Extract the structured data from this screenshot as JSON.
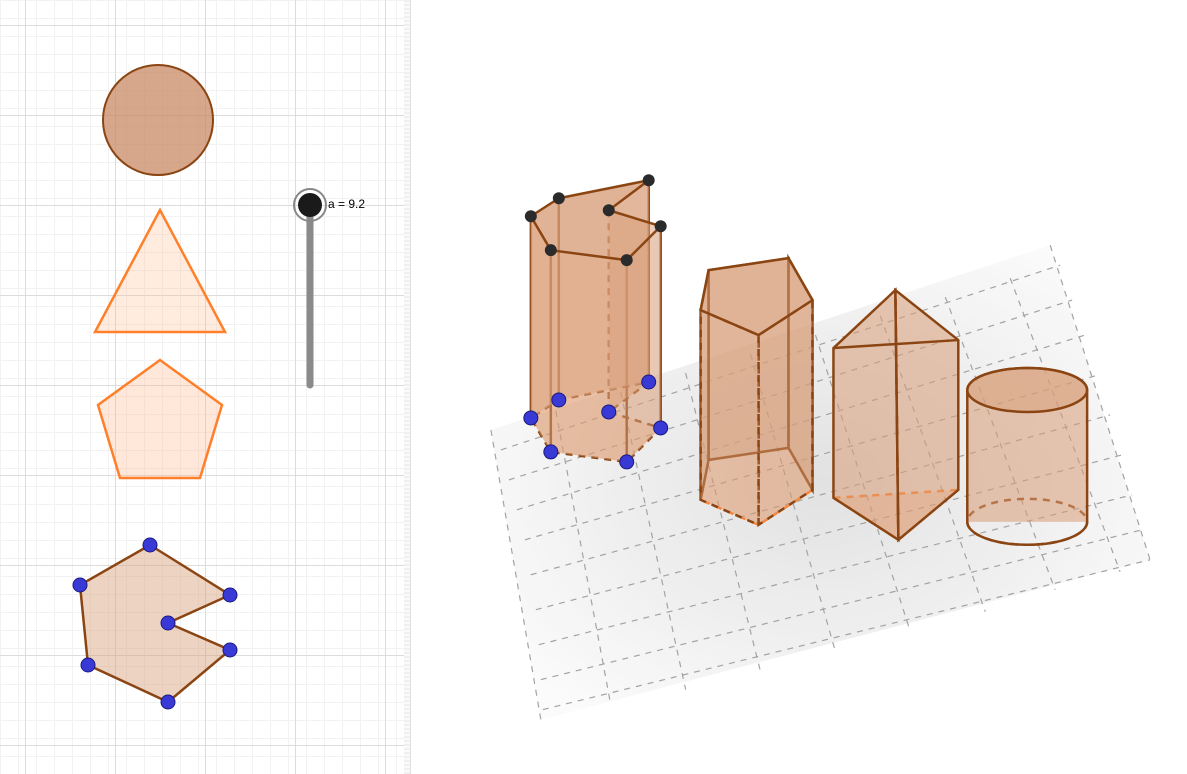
{
  "slider": {
    "name": "a",
    "value": "9.2",
    "label": "a = 9.2"
  },
  "shapes_2d": {
    "circle": {
      "type": "circle"
    },
    "triangle": {
      "type": "triangle"
    },
    "pentagon": {
      "type": "pentagon"
    },
    "polygon": {
      "type": "free-polygon",
      "vertex_count": 7
    }
  },
  "prisms_3d": {
    "count": 4,
    "items": [
      "free-polygon-prism",
      "pentagonal-prism",
      "triangular-prism",
      "cylinder"
    ]
  },
  "colors": {
    "fill": "#d89d77",
    "stroke_orange": "#ff7f2a",
    "stroke_brown": "#8b4513",
    "point_blue": "#3939d6",
    "point_dark": "#2b2b2b",
    "slider_gray": "#888888",
    "grid_floor": "#b5b5b5"
  }
}
